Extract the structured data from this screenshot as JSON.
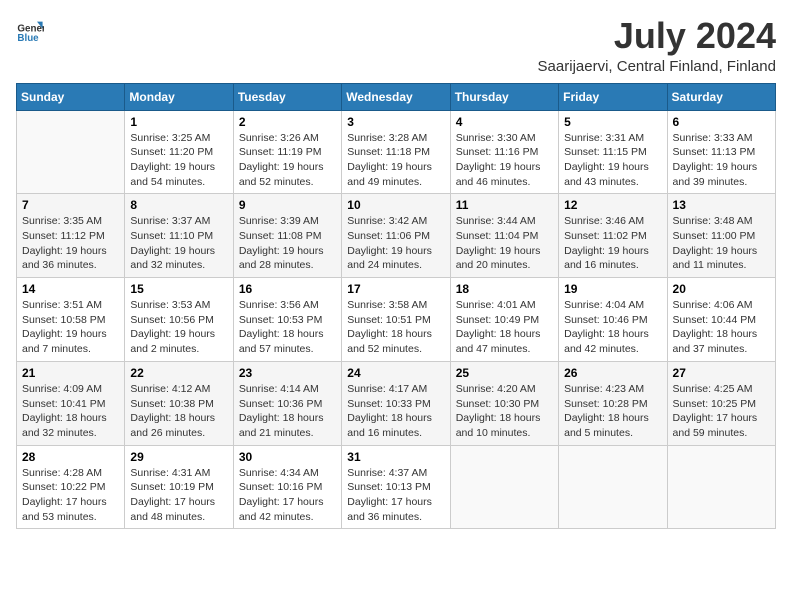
{
  "logo": {
    "general": "General",
    "blue": "Blue"
  },
  "title": "July 2024",
  "subtitle": "Saarijaervi, Central Finland, Finland",
  "headers": [
    "Sunday",
    "Monday",
    "Tuesday",
    "Wednesday",
    "Thursday",
    "Friday",
    "Saturday"
  ],
  "weeks": [
    [
      {
        "day": "",
        "info": ""
      },
      {
        "day": "1",
        "info": "Sunrise: 3:25 AM\nSunset: 11:20 PM\nDaylight: 19 hours\nand 54 minutes."
      },
      {
        "day": "2",
        "info": "Sunrise: 3:26 AM\nSunset: 11:19 PM\nDaylight: 19 hours\nand 52 minutes."
      },
      {
        "day": "3",
        "info": "Sunrise: 3:28 AM\nSunset: 11:18 PM\nDaylight: 19 hours\nand 49 minutes."
      },
      {
        "day": "4",
        "info": "Sunrise: 3:30 AM\nSunset: 11:16 PM\nDaylight: 19 hours\nand 46 minutes."
      },
      {
        "day": "5",
        "info": "Sunrise: 3:31 AM\nSunset: 11:15 PM\nDaylight: 19 hours\nand 43 minutes."
      },
      {
        "day": "6",
        "info": "Sunrise: 3:33 AM\nSunset: 11:13 PM\nDaylight: 19 hours\nand 39 minutes."
      }
    ],
    [
      {
        "day": "7",
        "info": "Sunrise: 3:35 AM\nSunset: 11:12 PM\nDaylight: 19 hours\nand 36 minutes."
      },
      {
        "day": "8",
        "info": "Sunrise: 3:37 AM\nSunset: 11:10 PM\nDaylight: 19 hours\nand 32 minutes."
      },
      {
        "day": "9",
        "info": "Sunrise: 3:39 AM\nSunset: 11:08 PM\nDaylight: 19 hours\nand 28 minutes."
      },
      {
        "day": "10",
        "info": "Sunrise: 3:42 AM\nSunset: 11:06 PM\nDaylight: 19 hours\nand 24 minutes."
      },
      {
        "day": "11",
        "info": "Sunrise: 3:44 AM\nSunset: 11:04 PM\nDaylight: 19 hours\nand 20 minutes."
      },
      {
        "day": "12",
        "info": "Sunrise: 3:46 AM\nSunset: 11:02 PM\nDaylight: 19 hours\nand 16 minutes."
      },
      {
        "day": "13",
        "info": "Sunrise: 3:48 AM\nSunset: 11:00 PM\nDaylight: 19 hours\nand 11 minutes."
      }
    ],
    [
      {
        "day": "14",
        "info": "Sunrise: 3:51 AM\nSunset: 10:58 PM\nDaylight: 19 hours\nand 7 minutes."
      },
      {
        "day": "15",
        "info": "Sunrise: 3:53 AM\nSunset: 10:56 PM\nDaylight: 19 hours\nand 2 minutes."
      },
      {
        "day": "16",
        "info": "Sunrise: 3:56 AM\nSunset: 10:53 PM\nDaylight: 18 hours\nand 57 minutes."
      },
      {
        "day": "17",
        "info": "Sunrise: 3:58 AM\nSunset: 10:51 PM\nDaylight: 18 hours\nand 52 minutes."
      },
      {
        "day": "18",
        "info": "Sunrise: 4:01 AM\nSunset: 10:49 PM\nDaylight: 18 hours\nand 47 minutes."
      },
      {
        "day": "19",
        "info": "Sunrise: 4:04 AM\nSunset: 10:46 PM\nDaylight: 18 hours\nand 42 minutes."
      },
      {
        "day": "20",
        "info": "Sunrise: 4:06 AM\nSunset: 10:44 PM\nDaylight: 18 hours\nand 37 minutes."
      }
    ],
    [
      {
        "day": "21",
        "info": "Sunrise: 4:09 AM\nSunset: 10:41 PM\nDaylight: 18 hours\nand 32 minutes."
      },
      {
        "day": "22",
        "info": "Sunrise: 4:12 AM\nSunset: 10:38 PM\nDaylight: 18 hours\nand 26 minutes."
      },
      {
        "day": "23",
        "info": "Sunrise: 4:14 AM\nSunset: 10:36 PM\nDaylight: 18 hours\nand 21 minutes."
      },
      {
        "day": "24",
        "info": "Sunrise: 4:17 AM\nSunset: 10:33 PM\nDaylight: 18 hours\nand 16 minutes."
      },
      {
        "day": "25",
        "info": "Sunrise: 4:20 AM\nSunset: 10:30 PM\nDaylight: 18 hours\nand 10 minutes."
      },
      {
        "day": "26",
        "info": "Sunrise: 4:23 AM\nSunset: 10:28 PM\nDaylight: 18 hours\nand 5 minutes."
      },
      {
        "day": "27",
        "info": "Sunrise: 4:25 AM\nSunset: 10:25 PM\nDaylight: 17 hours\nand 59 minutes."
      }
    ],
    [
      {
        "day": "28",
        "info": "Sunrise: 4:28 AM\nSunset: 10:22 PM\nDaylight: 17 hours\nand 53 minutes."
      },
      {
        "day": "29",
        "info": "Sunrise: 4:31 AM\nSunset: 10:19 PM\nDaylight: 17 hours\nand 48 minutes."
      },
      {
        "day": "30",
        "info": "Sunrise: 4:34 AM\nSunset: 10:16 PM\nDaylight: 17 hours\nand 42 minutes."
      },
      {
        "day": "31",
        "info": "Sunrise: 4:37 AM\nSunset: 10:13 PM\nDaylight: 17 hours\nand 36 minutes."
      },
      {
        "day": "",
        "info": ""
      },
      {
        "day": "",
        "info": ""
      },
      {
        "day": "",
        "info": ""
      }
    ]
  ]
}
